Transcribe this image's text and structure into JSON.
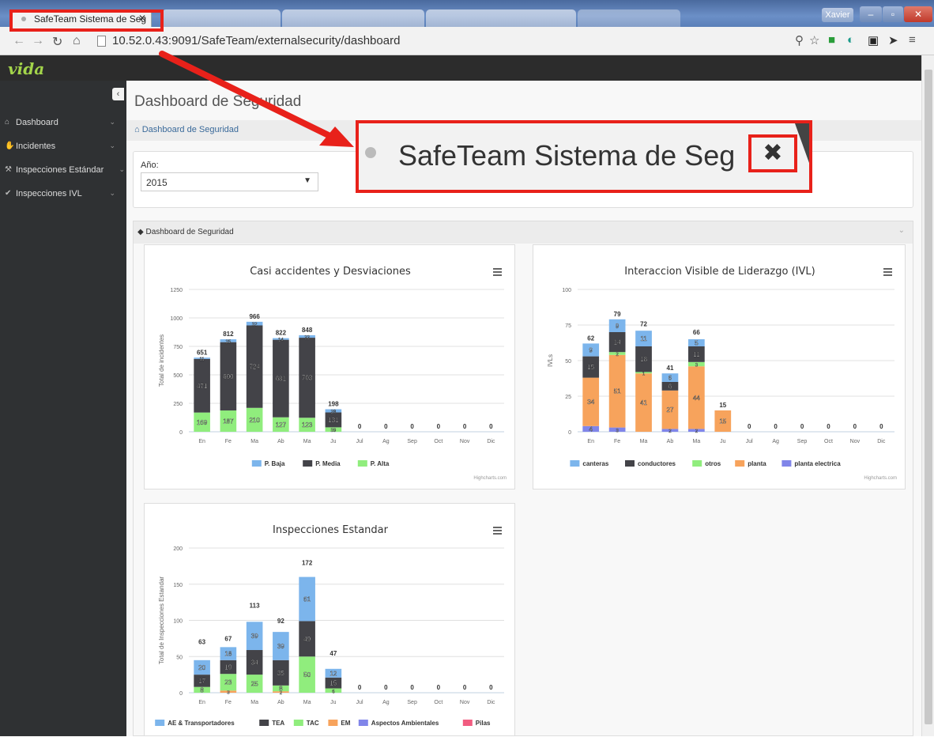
{
  "browser": {
    "active_tab": "SafeTeam Sistema de Seg",
    "url": "10.52.0.43:9091/SafeTeam/externalsecurity/dashboard",
    "user": "Xavier"
  },
  "app": {
    "logo": "vida",
    "sidebar": [
      {
        "label": "Dashboard",
        "icon": "home-icon"
      },
      {
        "label": "Incidentes",
        "icon": "thumbs-down-icon"
      },
      {
        "label": "Inspecciones Estándar",
        "icon": "gavel-icon"
      },
      {
        "label": "Inspecciones IVL",
        "icon": "check-icon"
      }
    ],
    "page_title": "Dashboard de Seguridad",
    "breadcrumb": "Dashboard de Seguridad",
    "year_label": "Año:",
    "year_value": "2015",
    "panel_title": "Dashboard de Seguridad"
  },
  "callout": {
    "text": "SafeTeam Sistema de Seg",
    "close_glyph": "✖"
  },
  "chart_data": [
    {
      "type": "bar",
      "stacked": true,
      "title": "Casi accidentes y Desviaciones",
      "ylabel": "Total de incidentes",
      "ylim": [
        0,
        1250
      ],
      "yticks": [
        0,
        250,
        500,
        750,
        1000,
        1250
      ],
      "categories": [
        "En",
        "Fe",
        "Ma",
        "Ab",
        "Ma",
        "Ju",
        "Jul",
        "Ag",
        "Sep",
        "Oct",
        "Nov",
        "Dic"
      ],
      "totals": [
        651,
        812,
        966,
        822,
        848,
        198,
        0,
        0,
        0,
        0,
        0,
        0
      ],
      "series": [
        {
          "name": "P. Alta",
          "color": "#90ed7d",
          "values": [
            169,
            187,
            210,
            127,
            123,
            39,
            0,
            0,
            0,
            0,
            0,
            0
          ]
        },
        {
          "name": "P. Media",
          "color": "#434348",
          "values": [
            471,
            600,
            724,
            681,
            703,
            131,
            0,
            0,
            0,
            0,
            0,
            0
          ]
        },
        {
          "name": "P. Baja",
          "color": "#7cb5ec",
          "values": [
            11,
            25,
            32,
            14,
            22,
            28,
            0,
            0,
            0,
            0,
            0,
            0
          ]
        }
      ],
      "legend_order": [
        "P. Baja",
        "P. Media",
        "P. Alta"
      ],
      "credit": "Highcharts.com"
    },
    {
      "type": "bar",
      "stacked": true,
      "title": "Interaccion Visible de Liderazgo (IVL)",
      "ylabel": "IVLs",
      "ylim": [
        0,
        100
      ],
      "yticks": [
        0,
        25,
        50,
        75,
        100
      ],
      "categories": [
        "En",
        "Fe",
        "Ma",
        "Ab",
        "Ma",
        "Ju",
        "Jul",
        "Ag",
        "Sep",
        "Oct",
        "Nov",
        "Dic"
      ],
      "totals": [
        62,
        79,
        72,
        41,
        66,
        15,
        0,
        0,
        0,
        0,
        0,
        0
      ],
      "series": [
        {
          "name": "planta electrica",
          "color": "#8085e9",
          "values": [
            4,
            3,
            0,
            2,
            2,
            0,
            0,
            0,
            0,
            0,
            0,
            0
          ]
        },
        {
          "name": "planta",
          "color": "#f7a35c",
          "values": [
            34,
            51,
            41,
            27,
            44,
            15,
            0,
            0,
            0,
            0,
            0,
            0
          ]
        },
        {
          "name": "otros",
          "color": "#90ed7d",
          "values": [
            0,
            2,
            1,
            0,
            3,
            0,
            0,
            0,
            0,
            0,
            0,
            0
          ]
        },
        {
          "name": "conductores",
          "color": "#434348",
          "values": [
            15,
            14,
            18,
            6,
            11,
            0,
            0,
            0,
            0,
            0,
            0,
            0
          ]
        },
        {
          "name": "canteras",
          "color": "#7cb5ec",
          "values": [
            9,
            9,
            11,
            6,
            5,
            0,
            0,
            0,
            0,
            0,
            0,
            0
          ]
        }
      ],
      "legend_order": [
        "canteras",
        "conductores",
        "otros",
        "planta",
        "planta electrica"
      ],
      "credit": "Highcharts.com"
    },
    {
      "type": "bar",
      "stacked": true,
      "title": "Inspecciones Estandar",
      "ylabel": "Total de Inspecciones Estandar",
      "ylim": [
        0,
        200
      ],
      "yticks": [
        0,
        50,
        100,
        150,
        200
      ],
      "categories": [
        "En",
        "Fe",
        "Ma",
        "Ab",
        "Ma",
        "Ju",
        "Jul",
        "Ag",
        "Sep",
        "Oct",
        "Nov",
        "Dic"
      ],
      "totals": [
        63,
        67,
        113,
        92,
        172,
        47,
        0,
        0,
        0,
        0,
        0,
        0
      ],
      "series": [
        {
          "name": "EM",
          "color": "#f7a35c",
          "values": [
            0,
            3,
            0,
            2,
            0,
            0,
            0,
            0,
            0,
            0,
            0,
            0
          ]
        },
        {
          "name": "TAC",
          "color": "#90ed7d",
          "values": [
            8,
            23,
            25,
            8,
            50,
            6,
            0,
            0,
            0,
            0,
            0,
            0
          ]
        },
        {
          "name": "TEA",
          "color": "#434348",
          "values": [
            17,
            19,
            34,
            35,
            49,
            15,
            0,
            0,
            0,
            0,
            0,
            0
          ]
        },
        {
          "name": "AE & Transportadores",
          "color": "#7cb5ec",
          "values": [
            20,
            18,
            39,
            39,
            61,
            12,
            0,
            0,
            0,
            0,
            0,
            0
          ]
        }
      ],
      "legend_order": [
        "AE & Transportadores",
        "TEA",
        "TAC",
        "EM",
        "Aspectos Ambientales",
        "Pilas"
      ],
      "legend_colors": {
        "AE & Transportadores": "#7cb5ec",
        "TEA": "#434348",
        "TAC": "#90ed7d",
        "EM": "#f7a35c",
        "Aspectos Ambientales": "#8085e9",
        "Pilas": "#f15c80"
      }
    }
  ]
}
